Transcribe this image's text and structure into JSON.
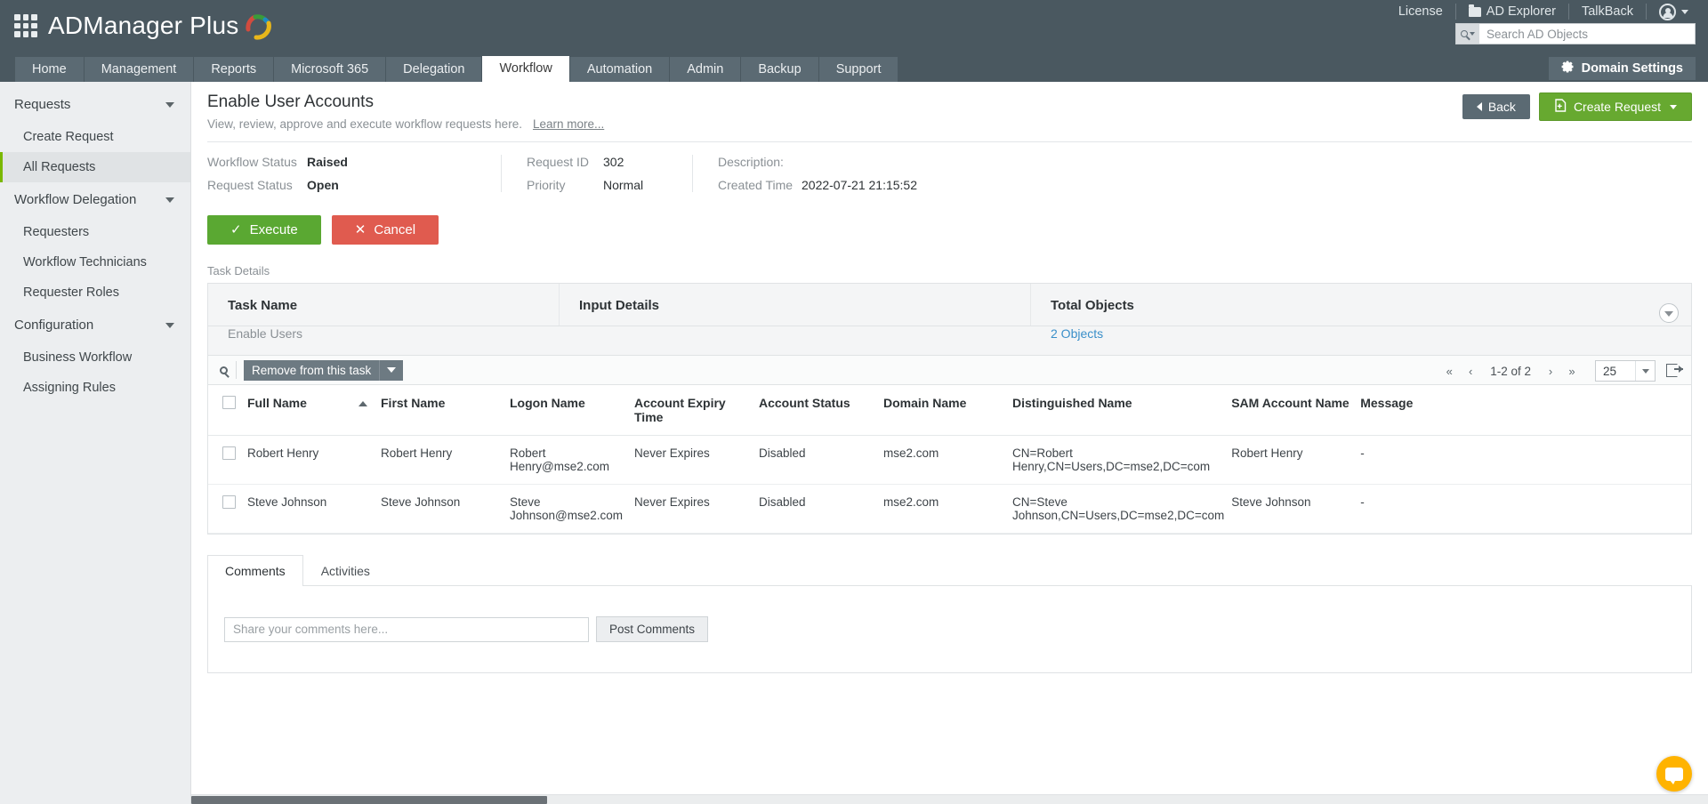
{
  "app": {
    "name": "ADManager Plus",
    "grid_icon": "apps-grid-icon"
  },
  "topbar": {
    "license": "License",
    "ad_explorer": "AD Explorer",
    "talkback": "TalkBack",
    "search_placeholder": "Search AD Objects",
    "search_value": ""
  },
  "nav": {
    "tabs": [
      {
        "label": "Home",
        "active": false
      },
      {
        "label": "Management",
        "active": false
      },
      {
        "label": "Reports",
        "active": false
      },
      {
        "label": "Microsoft 365",
        "active": false
      },
      {
        "label": "Delegation",
        "active": false
      },
      {
        "label": "Workflow",
        "active": true
      },
      {
        "label": "Automation",
        "active": false
      },
      {
        "label": "Admin",
        "active": false
      },
      {
        "label": "Backup",
        "active": false
      },
      {
        "label": "Support",
        "active": false
      }
    ],
    "domain_settings": "Domain Settings"
  },
  "sidebar": {
    "groups": [
      {
        "label": "Requests",
        "items": [
          {
            "label": "Create Request",
            "active": false
          },
          {
            "label": "All Requests",
            "active": true
          }
        ]
      },
      {
        "label": "Workflow Delegation",
        "items": [
          {
            "label": "Requesters",
            "active": false
          },
          {
            "label": "Workflow Technicians",
            "active": false
          },
          {
            "label": "Requester Roles",
            "active": false
          }
        ]
      },
      {
        "label": "Configuration",
        "items": [
          {
            "label": "Business Workflow",
            "active": false
          },
          {
            "label": "Assigning Rules",
            "active": false
          }
        ]
      }
    ]
  },
  "page": {
    "title": "Enable User Accounts",
    "subtitle": "View, review, approve and execute workflow requests here.",
    "learn_more": "Learn more...",
    "back_label": "Back",
    "create_request_label": "Create Request"
  },
  "info": {
    "workflow_status_label": "Workflow Status",
    "workflow_status_value": "Raised",
    "request_status_label": "Request Status",
    "request_status_value": "Open",
    "request_id_label": "Request ID",
    "request_id_value": "302",
    "priority_label": "Priority",
    "priority_value": "Normal",
    "description_label": "Description:",
    "description_value": "",
    "created_time_label": "Created Time",
    "created_time_value": "2022-07-21 21:15:52"
  },
  "actions": {
    "execute_label": "Execute",
    "cancel_label": "Cancel"
  },
  "task_details": {
    "section_label": "Task Details",
    "columns": [
      "Task Name",
      "Input Details",
      "Total Objects"
    ],
    "task_name": "Enable Users",
    "input_details": "",
    "total_objects": "2 Objects"
  },
  "toolbar": {
    "bulk_action_label": "Remove from this task",
    "page_info": "1-2 of 2",
    "page_size": "25",
    "first_page": "«",
    "prev_page": "‹",
    "next_page": "›",
    "last_page": "»"
  },
  "table": {
    "columns": [
      "Full Name",
      "First Name",
      "Logon Name",
      "Account Expiry Time",
      "Account Status",
      "Domain Name",
      "Distinguished Name",
      "SAM Account Name",
      "Message"
    ],
    "sort_column": "Full Name",
    "sort_direction": "asc",
    "rows": [
      {
        "full_name": "Robert Henry",
        "first_name": "Robert Henry",
        "logon_name": "Robert Henry@mse2.com",
        "account_expiry_time": "Never Expires",
        "account_status": "Disabled",
        "domain_name": "mse2.com",
        "distinguished_name": "CN=Robert Henry,CN=Users,DC=mse2,DC=com",
        "sam_account_name": "Robert Henry",
        "message": "-"
      },
      {
        "full_name": "Steve Johnson",
        "first_name": "Steve Johnson",
        "logon_name": "Steve Johnson@mse2.com",
        "account_expiry_time": "Never Expires",
        "account_status": "Disabled",
        "domain_name": "mse2.com",
        "distinguished_name": "CN=Steve Johnson,CN=Users,DC=mse2,DC=com",
        "sam_account_name": "Steve Johnson",
        "message": "-"
      }
    ]
  },
  "bottom": {
    "tabs": [
      {
        "label": "Comments",
        "active": true
      },
      {
        "label": "Activities",
        "active": false
      }
    ],
    "comment_placeholder": "Share your comments here...",
    "comment_value": "",
    "post_label": "Post Comments"
  },
  "colors": {
    "header_bg": "#4a5860",
    "accent_green": "#7ab800",
    "execute_green": "#5aa832",
    "cancel_red": "#e05b4f",
    "link_blue": "#3a8fc9",
    "chat_yellow": "#ffb300"
  }
}
